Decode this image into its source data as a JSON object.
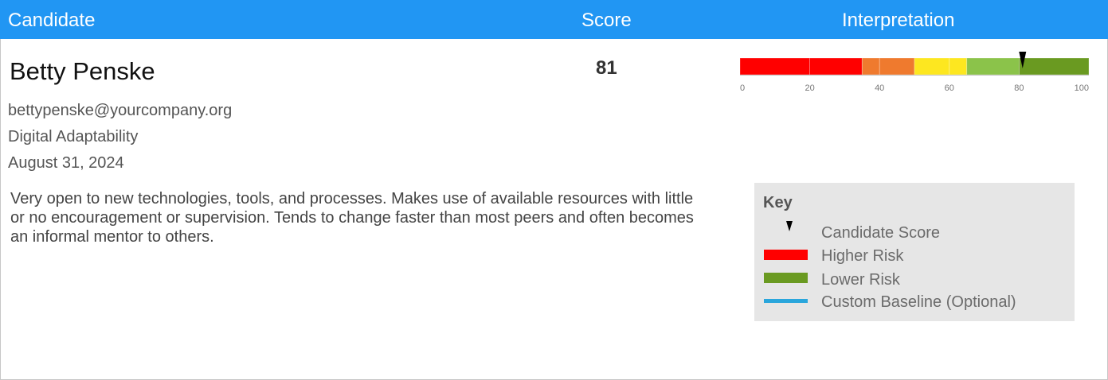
{
  "header": {
    "candidate_label": "Candidate",
    "score_label": "Score",
    "interpretation_label": "Interpretation"
  },
  "candidate": {
    "name": "Betty Penske",
    "email": "bettypenske@yourcompany.org",
    "assessment": "Digital Adaptability",
    "date": "August 31, 2024",
    "score": "81",
    "description": "Very open to new technologies, tools, and processes. Makes use of available resources with little or no encouragement or supervision. Tends to change faster than most peers and often becomes an informal mentor to others."
  },
  "chart_data": {
    "type": "bar",
    "orientation": "horizontal",
    "xlim": [
      0,
      100
    ],
    "ticks": [
      "0",
      "20",
      "40",
      "60",
      "80",
      "100"
    ],
    "bands": [
      {
        "from": 0,
        "to": 20,
        "color": "#ff0000"
      },
      {
        "from": 20,
        "to": 35,
        "color": "#ff0000"
      },
      {
        "from": 35,
        "to": 40,
        "color": "#ef7a2e"
      },
      {
        "from": 40,
        "to": 50,
        "color": "#ef7a2e"
      },
      {
        "from": 50,
        "to": 60,
        "color": "#fde720"
      },
      {
        "from": 60,
        "to": 65,
        "color": "#fde720"
      },
      {
        "from": 65,
        "to": 80,
        "color": "#8bc34a"
      },
      {
        "from": 80,
        "to": 100,
        "color": "#6a9a21"
      }
    ],
    "marker": 81
  },
  "key": {
    "title": "Key",
    "items": [
      {
        "label": "Candidate Score",
        "icon": "triangle-marker-icon"
      },
      {
        "label": "Higher Risk",
        "color": "#ff0000"
      },
      {
        "label": "Lower Risk",
        "color": "#6a9a21"
      },
      {
        "label": "Custom Baseline (Optional)",
        "color": "#2aa6dc"
      }
    ]
  }
}
